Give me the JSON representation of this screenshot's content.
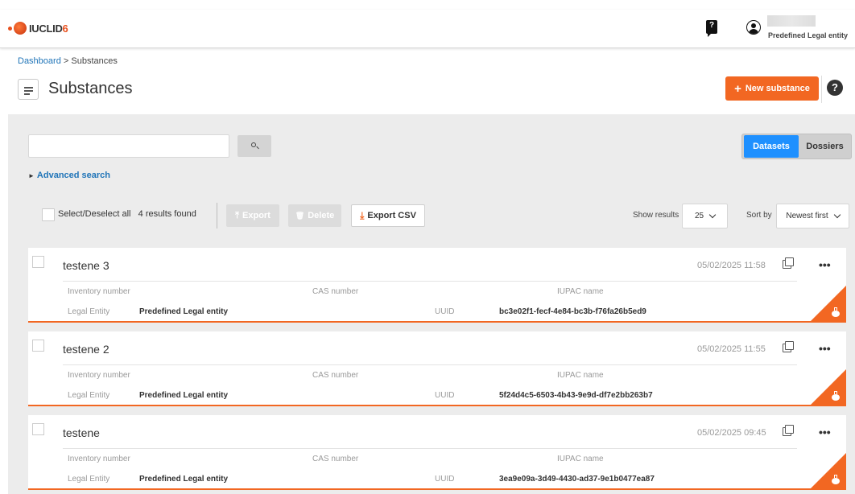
{
  "app": {
    "brand": "IUCLID",
    "brand_version": "6"
  },
  "header": {
    "user_entity": "Predefined Legal entity"
  },
  "breadcrumb": {
    "home": "Dashboard",
    "separator": " > ",
    "current": "Substances"
  },
  "page": {
    "title": "Substances",
    "new_button_label": "New substance",
    "new_button_icon": "+",
    "help_icon": "?"
  },
  "search": {
    "placeholder": "",
    "advanced_label": "Advanced search"
  },
  "view_toggle": {
    "datasets_label": "Datasets",
    "dossiers_label": "Dossiers",
    "active": "Datasets"
  },
  "actions": {
    "select_all_label": "Select/Deselect all",
    "results_label": "4 results found",
    "export_label": "Export",
    "delete_label": "Delete",
    "export_csv_label": "Export CSV",
    "show_results_label": "Show results",
    "show_results_value": "25",
    "sort_by_label": "Sort by",
    "sort_by_value": "Newest first"
  },
  "field_labels": {
    "inventory_number": "Inventory number",
    "cas_number": "CAS number",
    "iupac_name": "IUPAC name",
    "legal_entity": "Legal Entity",
    "uuid": "UUID"
  },
  "results": [
    {
      "name": "testene 3",
      "date": "05/02/2025 11:58",
      "legal_entity": "Predefined Legal entity",
      "uuid": "bc3e02f1-fecf-4e84-bc3b-f76fa26b5ed9"
    },
    {
      "name": "testene 2",
      "date": "05/02/2025 11:55",
      "legal_entity": "Predefined Legal entity",
      "uuid": "5f24d4c5-6503-4b43-9e9d-df7e2bb263b7"
    },
    {
      "name": "testene",
      "date": "05/02/2025 09:45",
      "legal_entity": "Predefined Legal entity",
      "uuid": "3ea9e09a-3d49-4430-ad37-9e1b0477ea87"
    }
  ],
  "colors": {
    "accent": "#f26722",
    "primary": "#1e90ff",
    "link": "#1f74b8"
  },
  "icons": {
    "dots": "•••",
    "download": "⤓",
    "upload": "⤒",
    "trash": "🗑",
    "triangle": "►"
  }
}
